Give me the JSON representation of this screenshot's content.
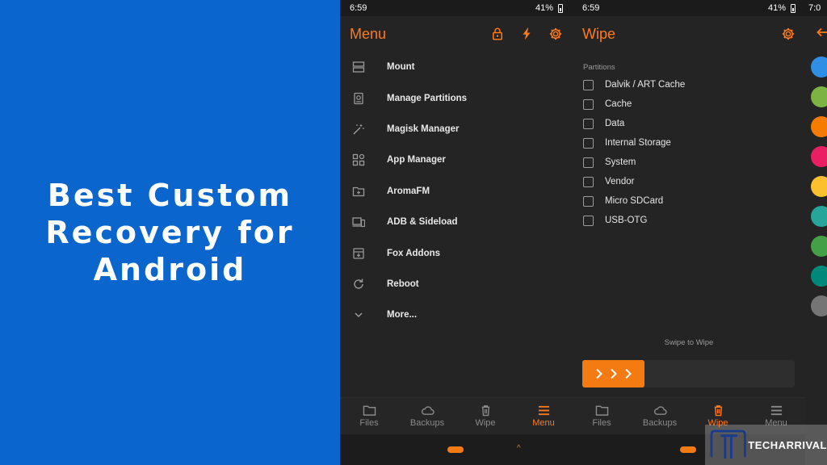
{
  "banner": {
    "title": "Best Custom\nRecovery for\nAndroid"
  },
  "colors": {
    "banner_bg": "#0a66cc",
    "accent": "#ff7a1a",
    "screen_bg": "#242424"
  },
  "menu_screen": {
    "status": {
      "time": "6:59",
      "battery": "41%"
    },
    "title": "Menu",
    "appbar_icons": [
      "lock-icon",
      "flash-icon",
      "gear-icon"
    ],
    "items": [
      {
        "icon": "mount-icon",
        "label": "Mount"
      },
      {
        "icon": "partitions-icon",
        "label": "Manage Partitions"
      },
      {
        "icon": "magic-wand-icon",
        "label": "Magisk Manager"
      },
      {
        "icon": "apps-icon",
        "label": "App Manager"
      },
      {
        "icon": "folder-icon",
        "label": "AromaFM"
      },
      {
        "icon": "devices-icon",
        "label": "ADB & Sideload"
      },
      {
        "icon": "addon-icon",
        "label": "Fox Addons"
      },
      {
        "icon": "refresh-icon",
        "label": "Reboot"
      },
      {
        "icon": "chevron-down-icon",
        "label": "More..."
      }
    ],
    "nav": [
      {
        "icon": "folder-icon",
        "label": "Files",
        "active": false
      },
      {
        "icon": "cloud-icon",
        "label": "Backups",
        "active": false
      },
      {
        "icon": "trash-icon",
        "label": "Wipe",
        "active": false
      },
      {
        "icon": "menu-icon",
        "label": "Menu",
        "active": true
      }
    ]
  },
  "wipe_screen": {
    "status": {
      "time": "6:59",
      "battery": "41%"
    },
    "title": "Wipe",
    "partitions_title": "Partitions",
    "partitions": [
      {
        "label": "Dalvik / ART Cache",
        "checked": false
      },
      {
        "label": "Cache",
        "checked": false
      },
      {
        "label": "Data",
        "checked": false
      },
      {
        "label": "Internal Storage",
        "checked": false
      },
      {
        "label": "System",
        "checked": false
      },
      {
        "label": "Vendor",
        "checked": false
      },
      {
        "label": "Micro SDCard",
        "checked": false
      },
      {
        "label": "USB-OTG",
        "checked": false
      }
    ],
    "swipe_label": "Swipe to Wipe",
    "nav": [
      {
        "icon": "folder-icon",
        "label": "Files",
        "active": false
      },
      {
        "icon": "cloud-icon",
        "label": "Backups",
        "active": false
      },
      {
        "icon": "trash-icon",
        "label": "Wipe",
        "active": true
      },
      {
        "icon": "menu-icon",
        "label": "Menu",
        "active": false
      }
    ]
  },
  "third_screen": {
    "status": {
      "time": "7:0"
    },
    "side_icons": [
      {
        "icon": "settings-icon",
        "color": "#2f8fe6"
      },
      {
        "icon": "download-icon",
        "color": "#7cb342"
      },
      {
        "icon": "brush-icon",
        "color": "#f57c00"
      },
      {
        "icon": "lock-icon",
        "color": "#e91e63"
      },
      {
        "icon": "gear-icon",
        "color": "#fbc02d"
      },
      {
        "icon": "vibrate-icon",
        "color": "#26a69a"
      },
      {
        "icon": "cloud-icon",
        "color": "#43a047"
      },
      {
        "icon": "globe-icon",
        "color": "#00897b"
      },
      {
        "icon": "info-icon",
        "color": "#757575"
      }
    ]
  },
  "watermark": {
    "text": "TECHARRIVAL"
  }
}
